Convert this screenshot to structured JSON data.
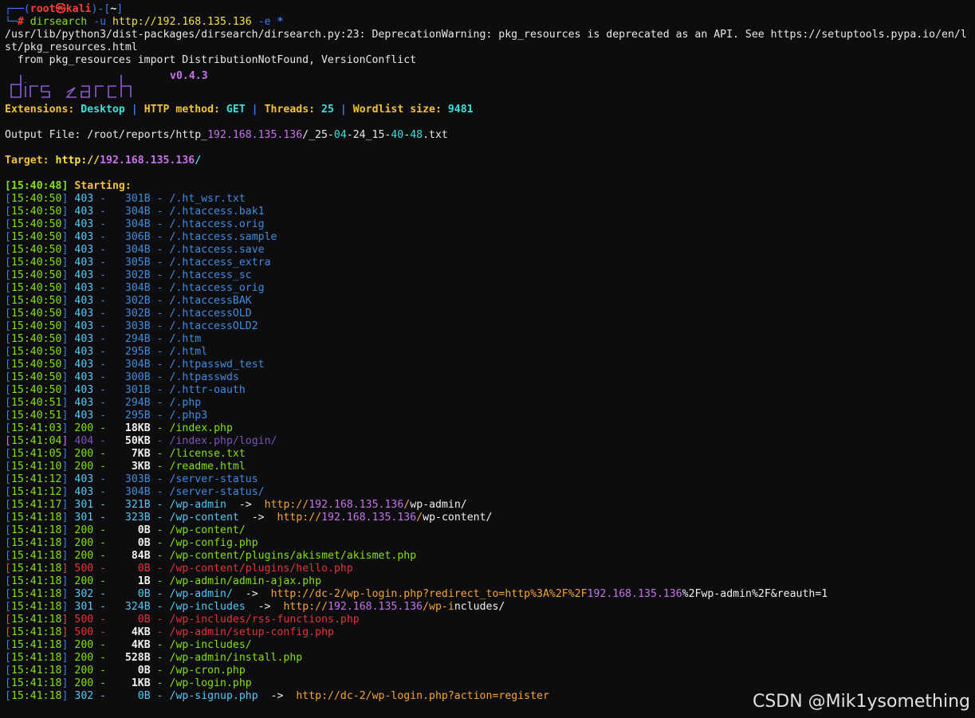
{
  "prompt": {
    "top_prefix": "┌──(",
    "user": "root㉿kali",
    "mid": ")-[",
    "dir": "~",
    "close": "]",
    "bottom_prefix": "└─",
    "hash": "# ",
    "cmd": "dirsearch",
    "arg1": " -u ",
    "url": "http://192.168.135.136",
    "arg2": " -e ",
    "star": "*"
  },
  "warning": {
    "line1": "/usr/lib/python3/dist-packages/dirsearch/dirsearch.py:23: DeprecationWarning: pkg_resources is deprecated as an API. See https://setuptools.pypa.io/en/l",
    "line2": "st/pkg_resources.html",
    "line3": "  from pkg_resources import DistributionNotFound, VersionConflict"
  },
  "banner": {
    "version": "v0.4.3",
    "logo": "dirsearch"
  },
  "config": {
    "ext_label": "Extensions: ",
    "ext_value": "Desktop",
    "sep": " | ",
    "method_label": "HTTP method: ",
    "method_value": "GET",
    "threads_label": "Threads: ",
    "threads_value": "25",
    "wordlist_label": "Wordlist size: ",
    "wordlist_value": "9481"
  },
  "output": {
    "label": "Output File: ",
    "p1": "/root/reports/http_",
    "p2": "192.168.135.136",
    "p3": "/_25-",
    "p4": "04",
    "p5": "-24_15-",
    "p6": "40",
    "p7": "-",
    "p8": "48",
    "p9": ".txt"
  },
  "target": {
    "label": "Target: ",
    "a": "http://",
    "b": "192.168.135.136",
    "c": "/"
  },
  "start": {
    "ts": "[15:40:48]",
    "label": " Starting:"
  },
  "rows": [
    {
      "t": "15:40:50",
      "code": "403",
      "size": "301B",
      "path": "/.ht_wsr.txt"
    },
    {
      "t": "15:40:50",
      "code": "403",
      "size": "304B",
      "path": "/.htaccess.bak1"
    },
    {
      "t": "15:40:50",
      "code": "403",
      "size": "304B",
      "path": "/.htaccess.orig"
    },
    {
      "t": "15:40:50",
      "code": "403",
      "size": "306B",
      "path": "/.htaccess.sample"
    },
    {
      "t": "15:40:50",
      "code": "403",
      "size": "304B",
      "path": "/.htaccess.save"
    },
    {
      "t": "15:40:50",
      "code": "403",
      "size": "305B",
      "path": "/.htaccess_extra"
    },
    {
      "t": "15:40:50",
      "code": "403",
      "size": "302B",
      "path": "/.htaccess_sc"
    },
    {
      "t": "15:40:50",
      "code": "403",
      "size": "304B",
      "path": "/.htaccess_orig"
    },
    {
      "t": "15:40:50",
      "code": "403",
      "size": "302B",
      "path": "/.htaccessBAK"
    },
    {
      "t": "15:40:50",
      "code": "403",
      "size": "302B",
      "path": "/.htaccessOLD"
    },
    {
      "t": "15:40:50",
      "code": "403",
      "size": "303B",
      "path": "/.htaccessOLD2"
    },
    {
      "t": "15:40:50",
      "code": "403",
      "size": "294B",
      "path": "/.htm"
    },
    {
      "t": "15:40:50",
      "code": "403",
      "size": "295B",
      "path": "/.html"
    },
    {
      "t": "15:40:50",
      "code": "403",
      "size": "304B",
      "path": "/.htpasswd_test"
    },
    {
      "t": "15:40:50",
      "code": "403",
      "size": "300B",
      "path": "/.htpasswds"
    },
    {
      "t": "15:40:50",
      "code": "403",
      "size": "301B",
      "path": "/.httr-oauth"
    },
    {
      "t": "15:40:51",
      "code": "403",
      "size": "294B",
      "path": "/.php"
    },
    {
      "t": "15:40:51",
      "code": "403",
      "size": "295B",
      "path": "/.php3"
    },
    {
      "t": "15:41:03",
      "code": "200",
      "size": "18KB",
      "path": "/index.php"
    },
    {
      "t": "15:41:04",
      "code": "404",
      "size": "50KB",
      "path": "/index.php/login/"
    },
    {
      "t": "15:41:05",
      "code": "200",
      "size": "7KB",
      "path": "/license.txt"
    },
    {
      "t": "15:41:10",
      "code": "200",
      "size": "3KB",
      "path": "/readme.html"
    },
    {
      "t": "15:41:12",
      "code": "403",
      "size": "303B",
      "path": "/server-status"
    },
    {
      "t": "15:41:12",
      "code": "403",
      "size": "304B",
      "path": "/server-status/"
    },
    {
      "t": "15:41:17",
      "code": "301",
      "size": "321B",
      "path": "/wp-admin",
      "r1": "http://",
      "r2": "192.168.135.136",
      "r3": "/",
      "r4": "w",
      "r5": "p-admin/"
    },
    {
      "t": "15:41:18",
      "code": "301",
      "size": "323B",
      "path": "/wp-content",
      "r1": "http://",
      "r2": "192.168.135.136",
      "r3": "/",
      "r4": "wp-",
      "r5": "content/"
    },
    {
      "t": "15:41:18",
      "code": "200",
      "size": "0B",
      "path": "/wp-content/"
    },
    {
      "t": "15:41:18",
      "code": "200",
      "size": "0B",
      "path": "/wp-config.php"
    },
    {
      "t": "15:41:18",
      "code": "200",
      "size": "84B",
      "path": "/wp-content/plugins/akismet/akismet.php"
    },
    {
      "t": "15:41:18",
      "code": "500",
      "size": "0B",
      "path": "/wp-content/plugins/hello.php"
    },
    {
      "t": "15:41:18",
      "code": "200",
      "size": "1B",
      "path": "/wp-admin/admin-ajax.php"
    },
    {
      "t": "15:41:18",
      "code": "302",
      "size": "0B",
      "path": "/wp-admin/",
      "r1": "http://dc-2/wp-login.php?redirect_to=http%3A%2F%2F",
      "r2": "192.168.135.136",
      "r3": "",
      "r4": "",
      "r5": "%2Fwp-admin%2F&reauth=1"
    },
    {
      "t": "15:41:18",
      "code": "301",
      "size": "324B",
      "path": "/wp-includes",
      "r1": "http://",
      "r2": "192.168.135.136",
      "r3": "/wp-i",
      "r4": "",
      "r5": "ncludes/"
    },
    {
      "t": "15:41:18",
      "code": "500",
      "size": "0B",
      "path": "/wp-includes/rss-functions.php"
    },
    {
      "t": "15:41:18",
      "code": "500",
      "size": "4KB",
      "path": "/wp-admin/setup-config.php"
    },
    {
      "t": "15:41:18",
      "code": "200",
      "size": "4KB",
      "path": "/wp-includes/"
    },
    {
      "t": "15:41:18",
      "code": "200",
      "size": "528B",
      "path": "/wp-admin/install.php"
    },
    {
      "t": "15:41:18",
      "code": "200",
      "size": "0B",
      "path": "/wp-cron.php"
    },
    {
      "t": "15:41:18",
      "code": "200",
      "size": "1KB",
      "path": "/wp-login.php"
    },
    {
      "t": "15:41:18",
      "code": "302",
      "size": "0B",
      "path": "/wp-signup.php",
      "r1": "http://dc-2/wp-login.php?action=register",
      "r2": "",
      "r3": "",
      "r4": "",
      "r5": ""
    }
  ],
  "watermark": "CSDN @Mik1ysomething"
}
